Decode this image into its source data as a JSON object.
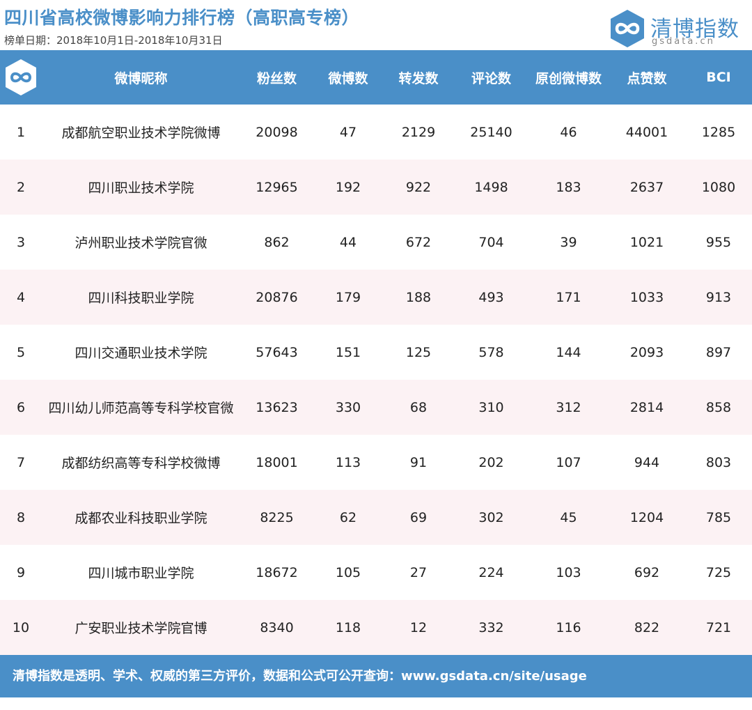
{
  "title": "四川省高校微博影响力排行榜（高职高专榜）",
  "date_line": "榜单日期：2018年10月1日-2018年10月31日",
  "brand": {
    "name": "清博指数",
    "sub": "gsdata.cn",
    "color": "#4a8fc8"
  },
  "table": {
    "headers": [
      "微博昵称",
      "粉丝数",
      "微博数",
      "转发数",
      "评论数",
      "原创微博数",
      "点赞数",
      "BCI"
    ],
    "rows": [
      [
        "1",
        "成都航空职业技术学院微博",
        "20098",
        "47",
        "2129",
        "25140",
        "46",
        "44001",
        "1285"
      ],
      [
        "2",
        "四川职业技术学院",
        "12965",
        "192",
        "922",
        "1498",
        "183",
        "2637",
        "1080"
      ],
      [
        "3",
        "泸州职业技术学院官微",
        "862",
        "44",
        "672",
        "704",
        "39",
        "1021",
        "955"
      ],
      [
        "4",
        "四川科技职业学院",
        "20876",
        "179",
        "188",
        "493",
        "171",
        "1033",
        "913"
      ],
      [
        "5",
        "四川交通职业技术学院",
        "57643",
        "151",
        "125",
        "578",
        "144",
        "2093",
        "897"
      ],
      [
        "6",
        "四川幼儿师范高等专科学校官微",
        "13623",
        "330",
        "68",
        "310",
        "312",
        "2814",
        "858"
      ],
      [
        "7",
        "成都纺织高等专科学校微博",
        "18001",
        "113",
        "91",
        "202",
        "107",
        "944",
        "803"
      ],
      [
        "8",
        "成都农业科技职业学院",
        "8225",
        "62",
        "69",
        "302",
        "45",
        "1204",
        "785"
      ],
      [
        "9",
        "四川城市职业学院",
        "18672",
        "105",
        "27",
        "224",
        "103",
        "692",
        "725"
      ],
      [
        "10",
        "广安职业技术学院官博",
        "8340",
        "118",
        "12",
        "332",
        "116",
        "822",
        "721"
      ]
    ]
  },
  "footer": "清博指数是透明、学术、权威的第三方评价，数据和公式可公开查询：www.gsdata.cn/site/usage"
}
